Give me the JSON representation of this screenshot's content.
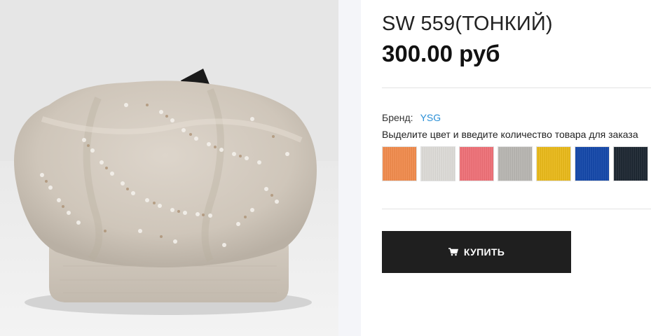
{
  "product": {
    "title": "SW 559(ТОНКИЙ)",
    "price": "300.00 руб",
    "brand_label": "Бренд:",
    "brand_value": "YSG",
    "instruction": "Выделите цвет и введите количество товара для заказа"
  },
  "image": {
    "subject": "beige knitted beret with rhinestones",
    "icon": "product-photo"
  },
  "swatches": [
    {
      "name": "orange",
      "color": "#f08a4b"
    },
    {
      "name": "light-gray",
      "color": "#dcdad6"
    },
    {
      "name": "pink",
      "color": "#ee6f76"
    },
    {
      "name": "gray-melange",
      "color": "#b7b5b1"
    },
    {
      "name": "mustard",
      "color": "#e8b818"
    },
    {
      "name": "blue",
      "color": "#1246a8"
    },
    {
      "name": "dark-navy",
      "color": "#1b2530"
    }
  ],
  "buy_button": {
    "label": "КУПИТЬ",
    "icon": "cart-icon"
  },
  "colors": {
    "button_bg": "#1f1f1f",
    "link": "#2a8fd6",
    "side_strip": "#f4f5f9"
  }
}
